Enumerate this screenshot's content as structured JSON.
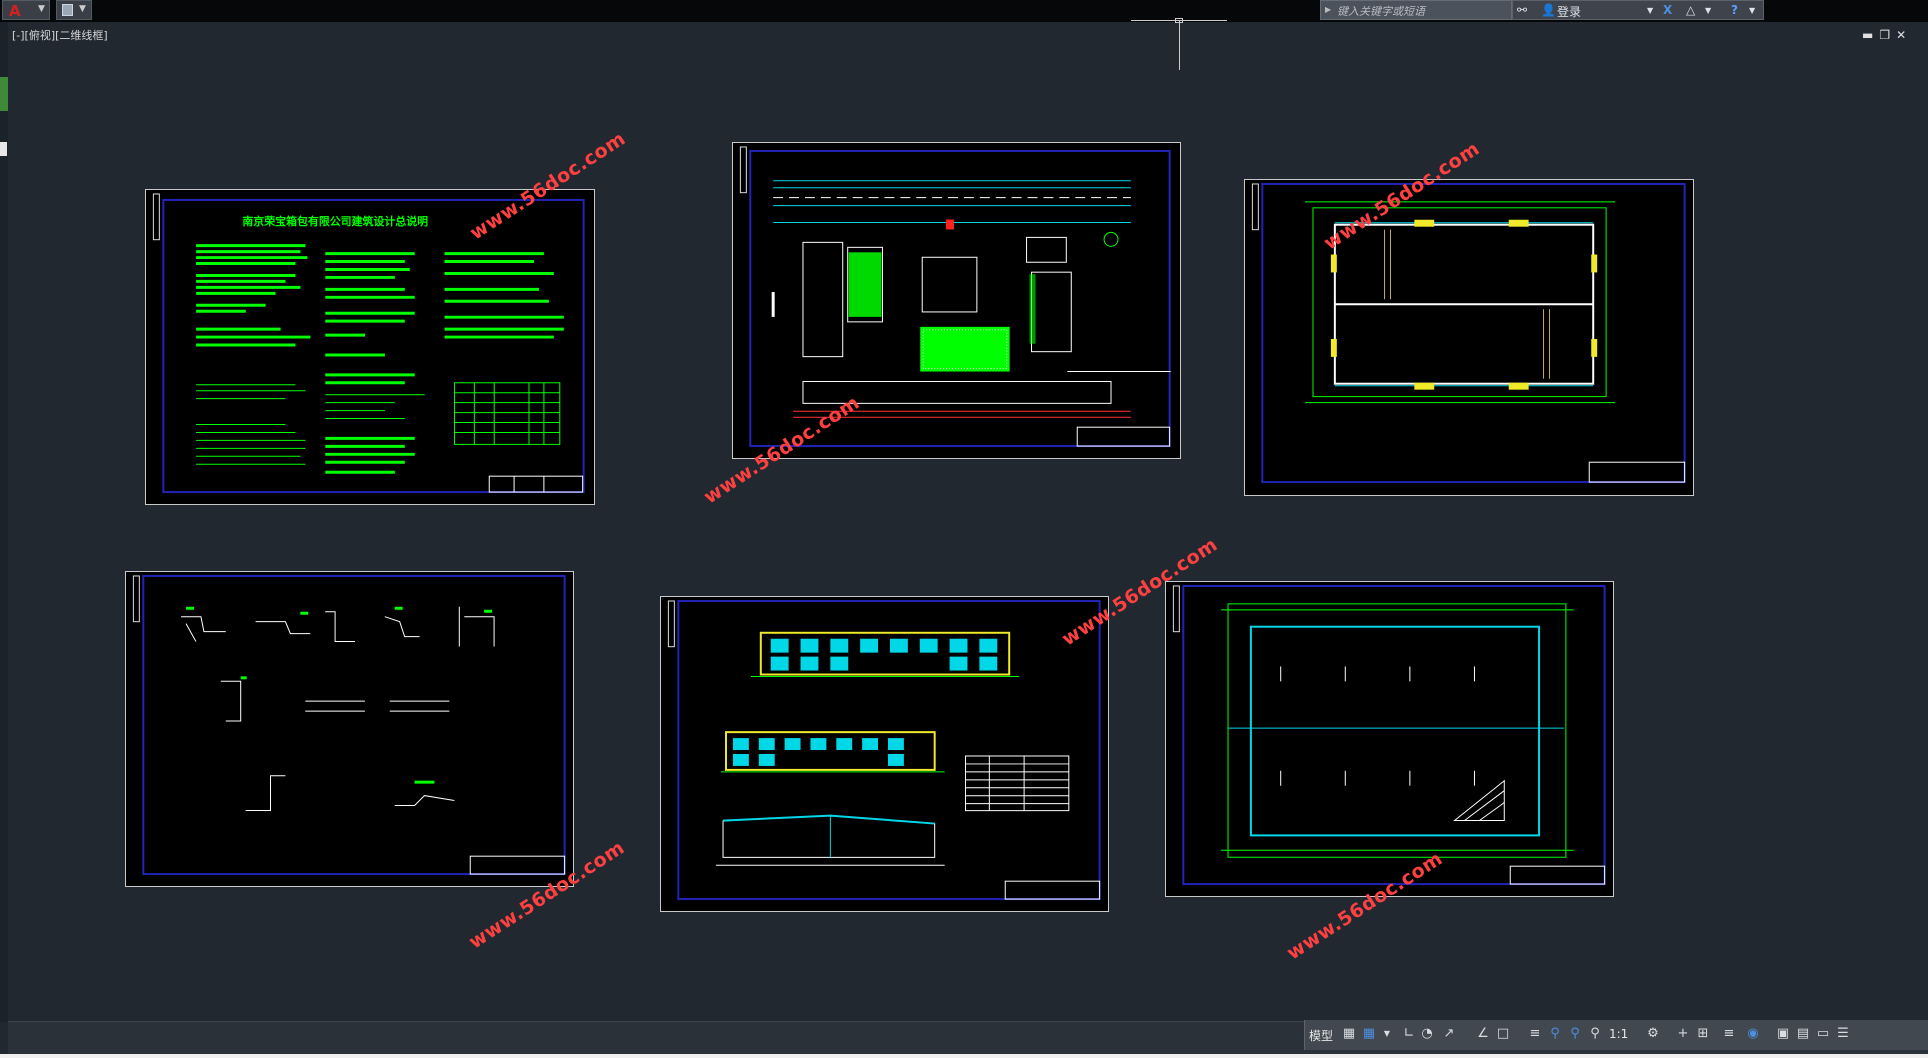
{
  "toolbar": {
    "search_placeholder": "键入关键字或短语",
    "login_label": "登录"
  },
  "viewport": {
    "label": "[-][俯视][二维线框]"
  },
  "sheets": [
    {
      "title": "南京荣宝箱包有限公司建筑设计总说明",
      "content": "design-notes"
    },
    {
      "title": "",
      "content": "site-plan"
    },
    {
      "title": "",
      "content": "floor-plan"
    },
    {
      "title": "",
      "content": "details"
    },
    {
      "title": "",
      "content": "elevations"
    },
    {
      "title": "",
      "content": "roof-plan"
    }
  ],
  "watermarks": [
    {
      "text": "www.56doc.com"
    },
    {
      "text": "www.56doc.com"
    },
    {
      "text": "www.56doc.com"
    },
    {
      "text": "www.56doc.com"
    },
    {
      "text": "www.56doc.com"
    },
    {
      "text": "www.56doc.com"
    },
    {
      "text": "www.56doc.com"
    }
  ],
  "statusbar": {
    "model_label": "模型",
    "scale_label": "1:1"
  },
  "colors": {
    "background": "#212830",
    "sheet": "#000000",
    "border": "#1f20a8",
    "text_green": "#00ff00",
    "line_white": "#ffffff",
    "line_cyan": "#00d8e8",
    "yellow": "#f0ea2a",
    "watermark": "#ff4040"
  }
}
